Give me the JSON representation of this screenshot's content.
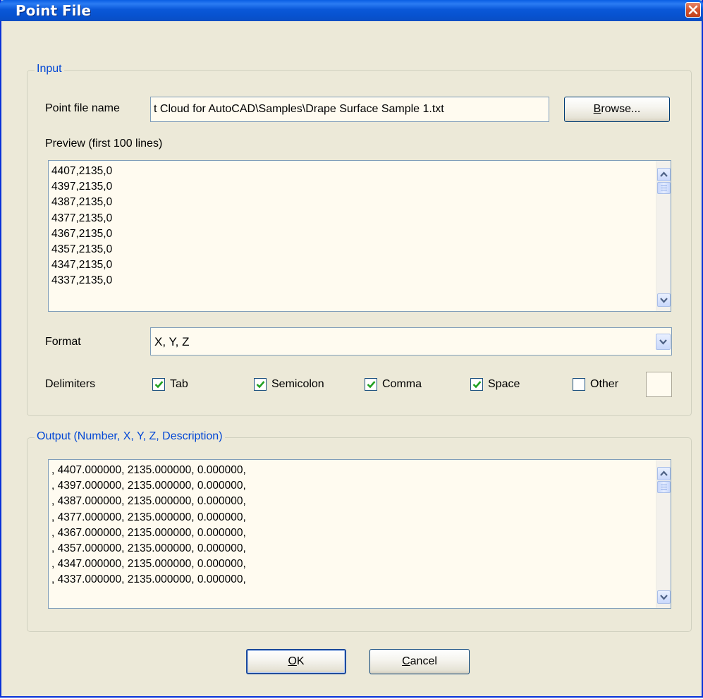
{
  "window": {
    "title": "Point File"
  },
  "input_group": {
    "legend": "Input",
    "point_file_label": "Point file name",
    "point_file_value": "t Cloud for AutoCAD\\Samples\\Drape Surface Sample 1.txt",
    "browse_label_accel": "B",
    "browse_label_rest": "rowse...",
    "preview_label": "Preview (first 100 lines)",
    "preview_lines": "4407,2135,0\n4397,2135,0\n4387,2135,0\n4377,2135,0\n4367,2135,0\n4357,2135,0\n4347,2135,0\n4337,2135,0",
    "format_label": "Format",
    "format_value": "X, Y, Z",
    "delimiters_label": "Delimiters",
    "delimiters": [
      {
        "label": "Tab",
        "checked": true
      },
      {
        "label": "Semicolon",
        "checked": true
      },
      {
        "label": "Comma",
        "checked": true
      },
      {
        "label": "Space",
        "checked": true
      },
      {
        "label": "Other",
        "checked": false
      }
    ],
    "other_value": ""
  },
  "output_group": {
    "legend": "Output (Number, X, Y, Z, Description)",
    "output_lines": ", 4407.000000, 2135.000000, 0.000000,\n, 4397.000000, 2135.000000, 0.000000,\n, 4387.000000, 2135.000000, 0.000000,\n, 4377.000000, 2135.000000, 0.000000,\n, 4367.000000, 2135.000000, 0.000000,\n, 4357.000000, 2135.000000, 0.000000,\n, 4347.000000, 2135.000000, 0.000000,\n, 4337.000000, 2135.000000, 0.000000,"
  },
  "buttons": {
    "ok_accel": "O",
    "ok_rest": "K",
    "cancel_accel": "C",
    "cancel_rest": "ancel"
  },
  "icons": {
    "close": "close-icon",
    "scroll_up": "chevron-up-icon",
    "scroll_down": "chevron-down-icon",
    "dropdown": "chevron-down-icon",
    "check": "checkmark-icon"
  },
  "colors": {
    "titlebar": "#0a58d8",
    "close": "#d4542e",
    "legend": "#0046d5",
    "field_bg": "#fffbf0",
    "dialog_bg": "#ece9d8",
    "check": "#21a121"
  }
}
